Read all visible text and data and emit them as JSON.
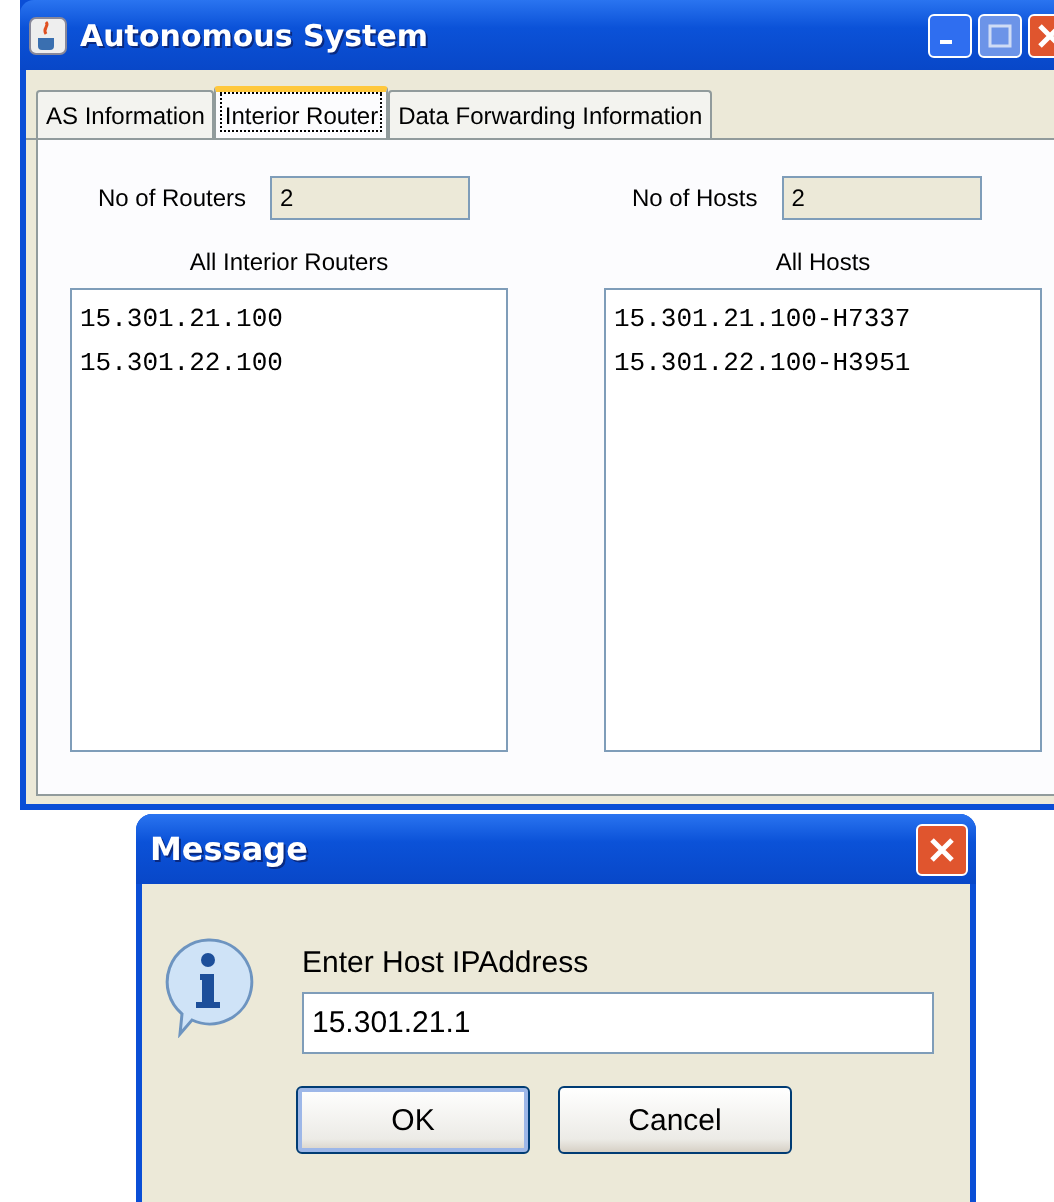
{
  "window": {
    "title": "Autonomous System"
  },
  "tabs": [
    {
      "label": "AS Information",
      "selected": false
    },
    {
      "label": "Interior Router",
      "selected": true
    },
    {
      "label": "Data Forwarding Information",
      "selected": false
    }
  ],
  "routers": {
    "count_label": "No of Routers",
    "count": "2",
    "list_title": "All Interior Routers",
    "items": [
      "15.301.21.100",
      "15.301.22.100"
    ]
  },
  "hosts": {
    "count_label": "No of Hosts",
    "count": "2",
    "list_title": "All Hosts",
    "items": [
      "15.301.21.100-H7337",
      "15.301.22.100-H3951"
    ]
  },
  "dialog": {
    "title": "Message",
    "prompt": "Enter Host IPAddress",
    "value": "15.301.21.1",
    "buttons": [
      "OK",
      "Cancel"
    ]
  }
}
